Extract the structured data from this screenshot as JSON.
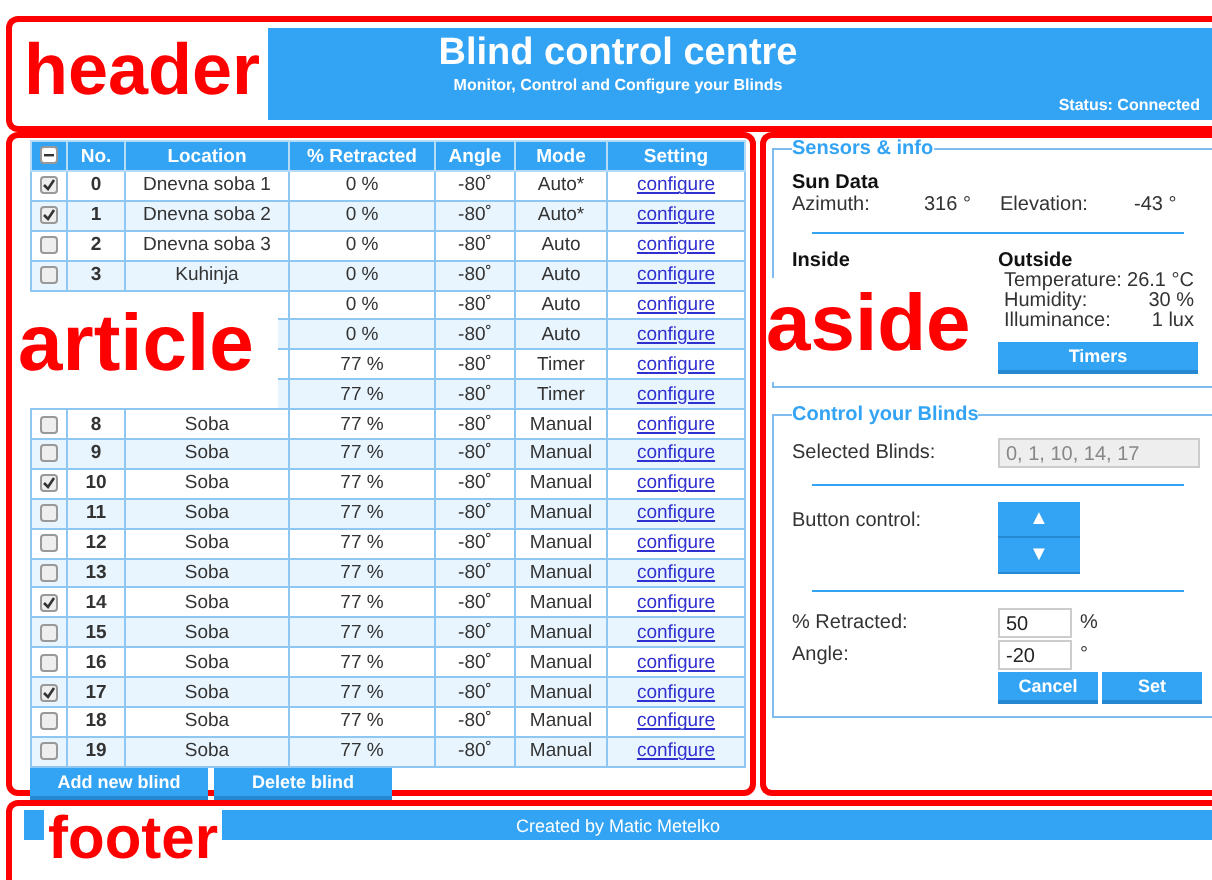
{
  "header": {
    "label": "header",
    "title": "Blind control centre",
    "subtitle": "Monitor, Control and Configure your Blinds",
    "status": "Status: Connected"
  },
  "article": {
    "label": "article",
    "select_all": {
      "indeterminate": true
    },
    "columns": [
      "No.",
      "Location",
      "% Retracted",
      "Angle",
      "Mode",
      "Setting"
    ],
    "rows": [
      {
        "checked": true,
        "no": "0",
        "location": "Dnevna soba 1",
        "retracted": "0 %",
        "angle": "-80˚",
        "mode": "Auto*",
        "setting": "configure"
      },
      {
        "checked": true,
        "no": "1",
        "location": "Dnevna soba 2",
        "retracted": "0 %",
        "angle": "-80˚",
        "mode": "Auto*",
        "setting": "configure"
      },
      {
        "checked": false,
        "no": "2",
        "location": "Dnevna soba 3",
        "retracted": "0 %",
        "angle": "-80˚",
        "mode": "Auto",
        "setting": "configure"
      },
      {
        "checked": false,
        "no": "3",
        "location": "Kuhinja",
        "retracted": "0 %",
        "angle": "-80˚",
        "mode": "Auto",
        "setting": "configure"
      },
      {
        "retracted": "0 %",
        "angle": "-80˚",
        "mode": "Auto",
        "setting": "configure"
      },
      {
        "retracted": "0 %",
        "angle": "-80˚",
        "mode": "Auto",
        "setting": "configure"
      },
      {
        "retracted": "77 %",
        "angle": "-80˚",
        "mode": "Timer",
        "setting": "configure"
      },
      {
        "retracted": "77 %",
        "angle": "-80˚",
        "mode": "Timer",
        "setting": "configure"
      },
      {
        "checked": false,
        "no": "8",
        "location": "Soba",
        "retracted": "77 %",
        "angle": "-80˚",
        "mode": "Manual",
        "setting": "configure"
      },
      {
        "checked": false,
        "no": "9",
        "location": "Soba",
        "retracted": "77 %",
        "angle": "-80˚",
        "mode": "Manual",
        "setting": "configure"
      },
      {
        "checked": true,
        "no": "10",
        "location": "Soba",
        "retracted": "77 %",
        "angle": "-80˚",
        "mode": "Manual",
        "setting": "configure"
      },
      {
        "checked": false,
        "no": "11",
        "location": "Soba",
        "retracted": "77 %",
        "angle": "-80˚",
        "mode": "Manual",
        "setting": "configure"
      },
      {
        "checked": false,
        "no": "12",
        "location": "Soba",
        "retracted": "77 %",
        "angle": "-80˚",
        "mode": "Manual",
        "setting": "configure"
      },
      {
        "checked": false,
        "no": "13",
        "location": "Soba",
        "retracted": "77 %",
        "angle": "-80˚",
        "mode": "Manual",
        "setting": "configure"
      },
      {
        "checked": true,
        "no": "14",
        "location": "Soba",
        "retracted": "77 %",
        "angle": "-80˚",
        "mode": "Manual",
        "setting": "configure"
      },
      {
        "checked": false,
        "no": "15",
        "location": "Soba",
        "retracted": "77 %",
        "angle": "-80˚",
        "mode": "Manual",
        "setting": "configure"
      },
      {
        "checked": false,
        "no": "16",
        "location": "Soba",
        "retracted": "77 %",
        "angle": "-80˚",
        "mode": "Manual",
        "setting": "configure"
      },
      {
        "checked": true,
        "no": "17",
        "location": "Soba",
        "retracted": "77 %",
        "angle": "-80˚",
        "mode": "Manual",
        "setting": "configure"
      },
      {
        "checked": false,
        "no": "18",
        "location": "Soba",
        "retracted": "77 %",
        "angle": "-80˚",
        "mode": "Manual",
        "setting": "configure"
      },
      {
        "checked": false,
        "no": "19",
        "location": "Soba",
        "retracted": "77 %",
        "angle": "-80˚",
        "mode": "Manual",
        "setting": "configure"
      }
    ],
    "buttons": [
      "Add new blind",
      "Delete blind"
    ]
  },
  "aside": {
    "label": "aside",
    "sensors": {
      "legend": "Sensors & info",
      "sun_title": "Sun Data",
      "sun": [
        {
          "label": "Azimuth:",
          "value": "316 °"
        },
        {
          "label": "Elevation:",
          "value": "-43 °"
        }
      ],
      "inside_title": "Inside",
      "outside_title": "Outside",
      "outside": [
        {
          "label": "Temperature:",
          "value": "26.1 °C"
        },
        {
          "label": "Humidity:",
          "value": "30 %"
        },
        {
          "label": "Illuminance:",
          "value": "1 lux"
        }
      ],
      "timers_button": "Timers"
    },
    "control": {
      "legend": "Control your Blinds",
      "selected_label": "Selected Blinds:",
      "selected_value": "0, 1, 10, 14, 17",
      "button_label": "Button control:",
      "up": "▲",
      "down": "▼",
      "fields": [
        {
          "label": "% Retracted:",
          "value": "50",
          "unit": "%"
        },
        {
          "label": "Angle:",
          "value": "-20",
          "unit": "°"
        }
      ],
      "buttons": [
        "Cancel",
        "Set"
      ]
    }
  },
  "footer": {
    "label": "footer",
    "credit": "Created by Matic Metelko"
  }
}
